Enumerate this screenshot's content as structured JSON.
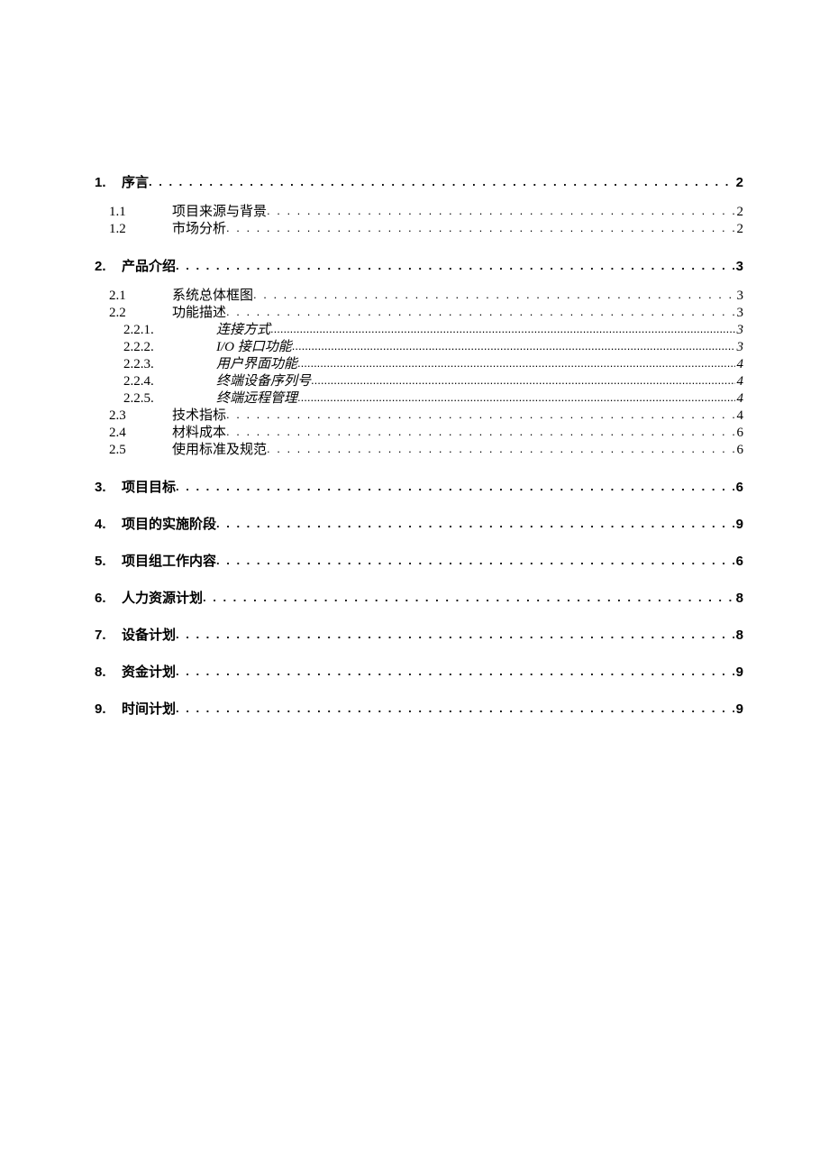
{
  "toc": [
    {
      "level": 1,
      "number": "1.",
      "title": "序言",
      "page": "2"
    },
    {
      "level": 2,
      "number": "1.1",
      "title": "项目来源与背景",
      "page": "2"
    },
    {
      "level": 2,
      "number": "1.2",
      "title": "市场分析",
      "page": "2"
    },
    {
      "level": 1,
      "number": "2.",
      "title": "产品介绍",
      "page": "3"
    },
    {
      "level": 2,
      "number": "2.1",
      "title": "系统总体框图",
      "page": "3"
    },
    {
      "level": 2,
      "number": "2.2",
      "title": "功能描述",
      "page": "3"
    },
    {
      "level": 3,
      "number": "2.2.1.",
      "title": "连接方式",
      "page": "3"
    },
    {
      "level": 3,
      "number": "2.2.2.",
      "title": "I/O 接口功能",
      "page": "3"
    },
    {
      "level": 3,
      "number": "2.2.3.",
      "title": "用户界面功能",
      "page": "4"
    },
    {
      "level": 3,
      "number": "2.2.4.",
      "title": "终端设备序列号",
      "page": "4"
    },
    {
      "level": 3,
      "number": "2.2.5.",
      "title": "终端远程管理",
      "page": "4"
    },
    {
      "level": 2,
      "number": "2.3",
      "title": "技术指标",
      "page": "4"
    },
    {
      "level": 2,
      "number": "2.4",
      "title": "材料成本",
      "page": "6"
    },
    {
      "level": 2,
      "number": "2.5",
      "title": "使用标准及规范",
      "page": "6"
    },
    {
      "level": 1,
      "number": "3.",
      "title": "项目目标",
      "page": "6"
    },
    {
      "level": 1,
      "number": "4.",
      "title": "项目的实施阶段",
      "page": "9"
    },
    {
      "level": 1,
      "number": "5.",
      "title": "项目组工作内容",
      "page": "6"
    },
    {
      "level": 1,
      "number": "6.",
      "title": "人力资源计划",
      "page": "8"
    },
    {
      "level": 1,
      "number": "7.",
      "title": "设备计划",
      "page": "8"
    },
    {
      "level": 1,
      "number": "8.",
      "title": "资金计划",
      "page": "9"
    },
    {
      "level": 1,
      "number": "9.",
      "title": "时间计划",
      "page": "9"
    }
  ]
}
